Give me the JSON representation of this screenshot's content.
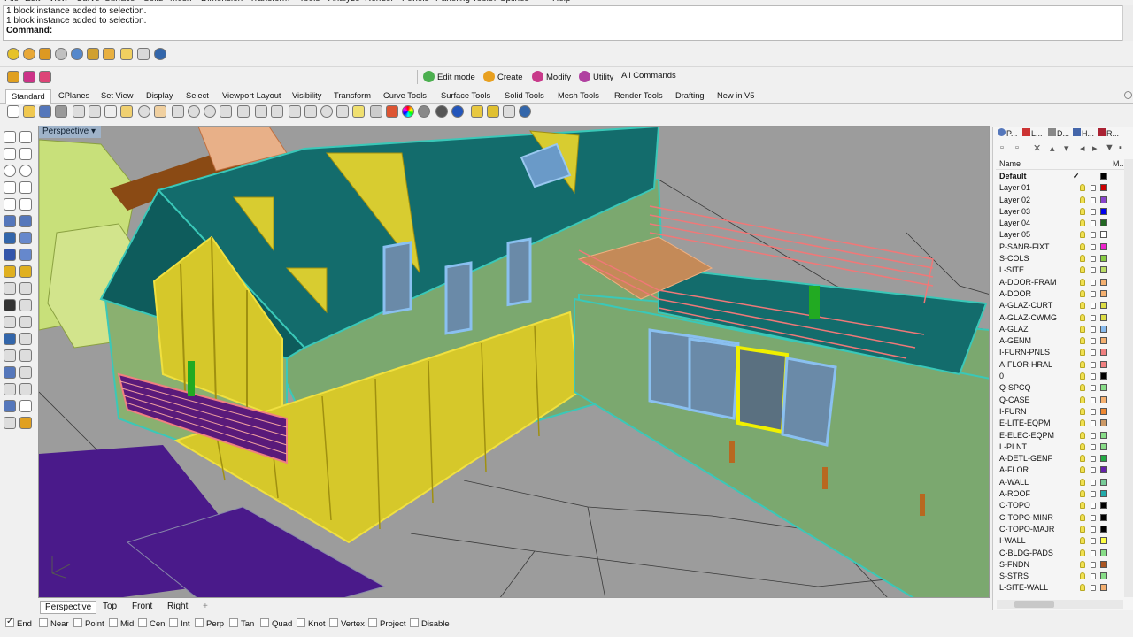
{
  "menu": [
    "File",
    "Edit",
    "View",
    "Curve",
    "Surface",
    "Solid",
    "Mesh",
    "Dimension",
    "Transform",
    "Tools",
    "Analyze",
    "Render",
    "Panels",
    "Paneling Tools",
    "T-Splines",
    "Help"
  ],
  "history": {
    "line1": "1 block instance added to selection.",
    "line2": "1 block instance added to selection.",
    "prompt": "Command:"
  },
  "commands": {
    "edit_mode": "Edit mode",
    "create": "Create",
    "modify": "Modify",
    "utility": "Utility",
    "all_commands": "All Commands"
  },
  "toolbar_tabs": [
    "Standard",
    "CPlanes",
    "Set View",
    "Display",
    "Select",
    "Viewport Layout",
    "Visibility",
    "Transform",
    "Curve Tools",
    "Surface Tools",
    "Solid Tools",
    "Mesh Tools",
    "Render Tools",
    "Drafting",
    "New in V5"
  ],
  "viewport": {
    "label": "Perspective",
    "tabs": [
      "Perspective",
      "Top",
      "Front",
      "Right"
    ],
    "add_tab": "+"
  },
  "osnap": [
    {
      "label": "End",
      "checked": true
    },
    {
      "label": "Near",
      "checked": false
    },
    {
      "label": "Point",
      "checked": false
    },
    {
      "label": "Mid",
      "checked": false
    },
    {
      "label": "Cen",
      "checked": false
    },
    {
      "label": "Int",
      "checked": false
    },
    {
      "label": "Perp",
      "checked": false
    },
    {
      "label": "Tan",
      "checked": false
    },
    {
      "label": "Quad",
      "checked": false
    },
    {
      "label": "Knot",
      "checked": false
    },
    {
      "label": "Vertex",
      "checked": false
    },
    {
      "label": "Project",
      "checked": false
    },
    {
      "label": "Disable",
      "checked": false
    }
  ],
  "panel": {
    "tabs": [
      "P...",
      "L...",
      "D...",
      "H...",
      "R..."
    ],
    "col_name": "Name",
    "col_material": "M...",
    "layers": [
      {
        "name": "Default",
        "color": "#000000",
        "current": true
      },
      {
        "name": "Layer 01",
        "color": "#cc0000"
      },
      {
        "name": "Layer 02",
        "color": "#8844cc"
      },
      {
        "name": "Layer 03",
        "color": "#0000ee"
      },
      {
        "name": "Layer 04",
        "color": "#226622"
      },
      {
        "name": "Layer 05",
        "color": "#ffffff"
      },
      {
        "name": "P-SANR-FIXT",
        "color": "#ee22cc"
      },
      {
        "name": "S-COLS",
        "color": "#88cc44"
      },
      {
        "name": "L-SITE",
        "color": "#bbdd66"
      },
      {
        "name": "A-DOOR-FRAM",
        "color": "#f4b070"
      },
      {
        "name": "A-DOOR",
        "color": "#f4b070"
      },
      {
        "name": "A-GLAZ-CURT",
        "color": "#dddd44"
      },
      {
        "name": "A-GLAZ-CWMG",
        "color": "#dddd44"
      },
      {
        "name": "A-GLAZ",
        "color": "#88bbee"
      },
      {
        "name": "A-GENM",
        "color": "#f4b070"
      },
      {
        "name": "I-FURN-PNLS",
        "color": "#f08080"
      },
      {
        "name": "A-FLOR-HRAL",
        "color": "#f08080"
      },
      {
        "name": "0",
        "color": "#000000"
      },
      {
        "name": "Q-SPCQ",
        "color": "#88dd88"
      },
      {
        "name": "Q-CASE",
        "color": "#f4b070"
      },
      {
        "name": "I-FURN",
        "color": "#ee8833"
      },
      {
        "name": "E-LITE-EQPM",
        "color": "#cc9966"
      },
      {
        "name": "E-ELEC-EQPM",
        "color": "#88dd88"
      },
      {
        "name": "L-PLNT",
        "color": "#88dd88"
      },
      {
        "name": "A-DETL-GENF",
        "color": "#22aa44"
      },
      {
        "name": "A-FLOR",
        "color": "#6622aa"
      },
      {
        "name": "A-WALL",
        "color": "#77cc99"
      },
      {
        "name": "A-ROOF",
        "color": "#22aaaa"
      },
      {
        "name": "C-TOPO",
        "color": "#000000"
      },
      {
        "name": "C-TOPO-MINR",
        "color": "#000000"
      },
      {
        "name": "C-TOPO-MAJR",
        "color": "#000000"
      },
      {
        "name": "I-WALL",
        "color": "#ffff44"
      },
      {
        "name": "C-BLDG-PADS",
        "color": "#88dd88"
      },
      {
        "name": "S-FNDN",
        "color": "#aa5522"
      },
      {
        "name": "S-STRS",
        "color": "#88dd88"
      },
      {
        "name": "L-SITE-WALL",
        "color": "#f4b070"
      }
    ]
  }
}
